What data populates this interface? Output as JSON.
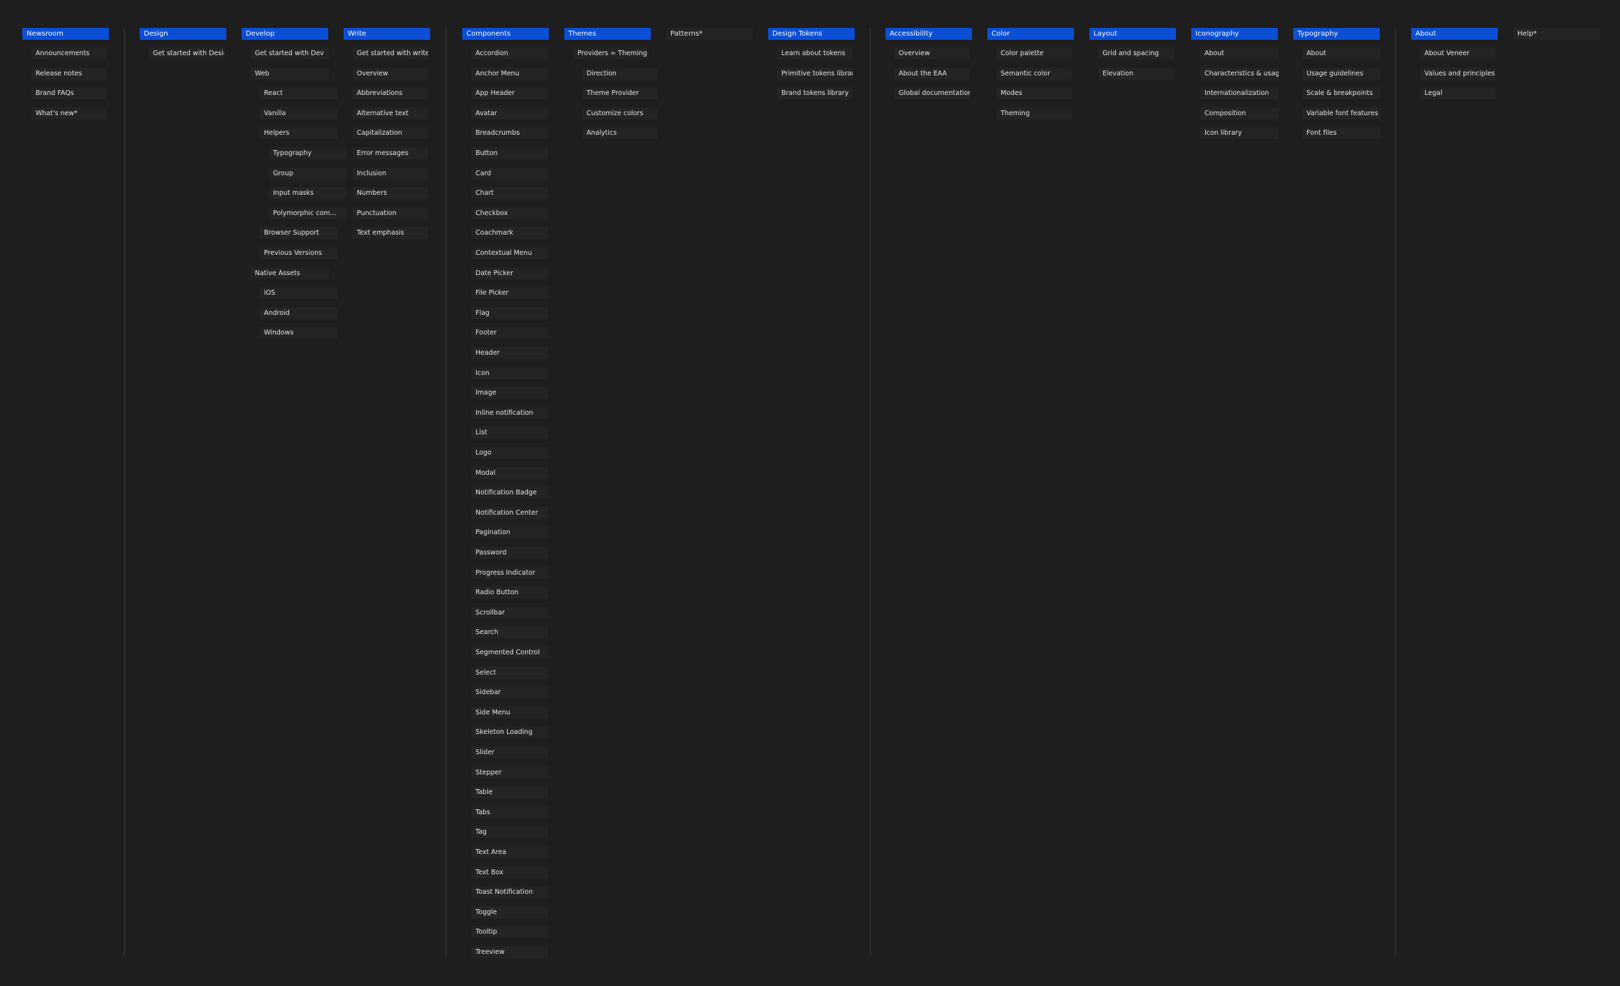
{
  "colors": {
    "background": "#1e1e1e",
    "section_header": "#0b4fd6",
    "item_box": "#242424",
    "divider": "#3e3e3e",
    "text": "#e4e4e4"
  },
  "sections": [
    {
      "id": "newsroom",
      "title": "Newsroom",
      "header_style": "primary",
      "items": [
        {
          "label": "Announcements",
          "level": 1
        },
        {
          "label": "Release notes",
          "level": 1
        },
        {
          "label": "Brand FAQs",
          "level": 1
        },
        {
          "label": "What's new*",
          "level": 1
        }
      ]
    },
    {
      "id": "design",
      "title": "Design",
      "header_style": "primary",
      "items": [
        {
          "label": "Get started with Design",
          "level": 1
        }
      ]
    },
    {
      "id": "develop",
      "title": "Develop",
      "header_style": "primary",
      "items": [
        {
          "label": "Get started with Dev",
          "level": 1
        },
        {
          "label": "Web",
          "level": 1
        },
        {
          "label": "React",
          "level": 2
        },
        {
          "label": "Vanilla",
          "level": 2
        },
        {
          "label": "Helpers",
          "level": 2
        },
        {
          "label": "Typography",
          "level": 3
        },
        {
          "label": "Group",
          "level": 3
        },
        {
          "label": "Input masks",
          "level": 3
        },
        {
          "label": "Polymorphic com...",
          "level": 3
        },
        {
          "label": "Browser Support",
          "level": 2
        },
        {
          "label": "Previous Versions",
          "level": 2
        },
        {
          "label": "Native Assets",
          "level": 1
        },
        {
          "label": "iOS",
          "level": 2
        },
        {
          "label": "Android",
          "level": 2
        },
        {
          "label": "Windows",
          "level": 2
        }
      ]
    },
    {
      "id": "write",
      "title": "Write",
      "header_style": "primary",
      "items": [
        {
          "label": "Get started with write",
          "level": 1
        },
        {
          "label": "Overview",
          "level": 1
        },
        {
          "label": "Abbreviations",
          "level": 1
        },
        {
          "label": "Alternative text",
          "level": 1
        },
        {
          "label": "Capitalization",
          "level": 1
        },
        {
          "label": "Error messages",
          "level": 1
        },
        {
          "label": "Inclusion",
          "level": 1
        },
        {
          "label": "Numbers",
          "level": 1
        },
        {
          "label": "Punctuation",
          "level": 1
        },
        {
          "label": "Text emphasis",
          "level": 1
        }
      ]
    },
    {
      "id": "components",
      "title": "Components",
      "header_style": "primary",
      "items": [
        {
          "label": "Accordion",
          "level": 1
        },
        {
          "label": "Anchor Menu",
          "level": 1
        },
        {
          "label": "App Header",
          "level": 1
        },
        {
          "label": "Avatar",
          "level": 1
        },
        {
          "label": "Breadcrumbs",
          "level": 1
        },
        {
          "label": "Button",
          "level": 1
        },
        {
          "label": "Card",
          "level": 1
        },
        {
          "label": "Chart",
          "level": 1
        },
        {
          "label": "Checkbox",
          "level": 1
        },
        {
          "label": "Coachmark",
          "level": 1
        },
        {
          "label": "Contextual Menu",
          "level": 1
        },
        {
          "label": "Date Picker",
          "level": 1
        },
        {
          "label": "File Picker",
          "level": 1
        },
        {
          "label": "Flag",
          "level": 1
        },
        {
          "label": "Footer",
          "level": 1
        },
        {
          "label": "Header",
          "level": 1
        },
        {
          "label": "Icon",
          "level": 1
        },
        {
          "label": "Image",
          "level": 1
        },
        {
          "label": "Inline notification",
          "level": 1
        },
        {
          "label": "List",
          "level": 1
        },
        {
          "label": "Logo",
          "level": 1
        },
        {
          "label": "Modal",
          "level": 1
        },
        {
          "label": "Notification Badge",
          "level": 1
        },
        {
          "label": "Notification Center",
          "level": 1
        },
        {
          "label": "Pagination",
          "level": 1
        },
        {
          "label": "Password",
          "level": 1
        },
        {
          "label": "Progress Indicator",
          "level": 1
        },
        {
          "label": "Radio Button",
          "level": 1
        },
        {
          "label": "Scrollbar",
          "level": 1
        },
        {
          "label": "Search",
          "level": 1
        },
        {
          "label": "Segmented Control",
          "level": 1
        },
        {
          "label": "Select",
          "level": 1
        },
        {
          "label": "Sidebar",
          "level": 1
        },
        {
          "label": "Side Menu",
          "level": 1
        },
        {
          "label": "Skeleton Loading",
          "level": 1
        },
        {
          "label": "Slider",
          "level": 1
        },
        {
          "label": "Stepper",
          "level": 1
        },
        {
          "label": "Table",
          "level": 1
        },
        {
          "label": "Tabs",
          "level": 1
        },
        {
          "label": "Tag",
          "level": 1
        },
        {
          "label": "Text Area",
          "level": 1
        },
        {
          "label": "Text Box",
          "level": 1
        },
        {
          "label": "Toast Notification",
          "level": 1
        },
        {
          "label": "Toggle",
          "level": 1
        },
        {
          "label": "Tooltip",
          "level": 1
        },
        {
          "label": "Treeview",
          "level": 1
        }
      ]
    },
    {
      "id": "themes",
      "title": "Themes",
      "header_style": "primary",
      "items": [
        {
          "label": "Providers = Theming",
          "level": 1
        },
        {
          "label": "Direction",
          "level": 2
        },
        {
          "label": "Theme Provider",
          "level": 2
        },
        {
          "label": "Customize colors",
          "level": 2
        },
        {
          "label": "Analytics",
          "level": 2
        }
      ]
    },
    {
      "id": "patterns",
      "title": "Patterns*",
      "header_style": "plain",
      "items": []
    },
    {
      "id": "design-tokens",
      "title": "Design Tokens",
      "header_style": "primary",
      "items": [
        {
          "label": "Learn about tokens",
          "level": 1
        },
        {
          "label": "Primitive tokens library",
          "level": 1
        },
        {
          "label": "Brand tokens library",
          "level": 1
        }
      ]
    },
    {
      "id": "accessibility",
      "title": "Accessibility",
      "header_style": "primary",
      "items": [
        {
          "label": "Overview",
          "level": 1
        },
        {
          "label": "About the EAA",
          "level": 1
        },
        {
          "label": "Global documentation*",
          "level": 1
        }
      ]
    },
    {
      "id": "color",
      "title": "Color",
      "header_style": "primary",
      "items": [
        {
          "label": "Color palette",
          "level": 1
        },
        {
          "label": "Semantic color",
          "level": 1
        },
        {
          "label": "Modes",
          "level": 1
        },
        {
          "label": "Theming",
          "level": 1
        }
      ]
    },
    {
      "id": "layout",
      "title": "Layout",
      "header_style": "primary",
      "items": [
        {
          "label": "Grid and spacing",
          "level": 1
        },
        {
          "label": "Elevation",
          "level": 1
        }
      ]
    },
    {
      "id": "iconography",
      "title": "Iconography",
      "header_style": "primary",
      "items": [
        {
          "label": "About",
          "level": 1
        },
        {
          "label": "Characteristics & usage",
          "level": 1
        },
        {
          "label": "Internationalization",
          "level": 1
        },
        {
          "label": "Composition",
          "level": 1
        },
        {
          "label": "Icon library",
          "level": 1
        }
      ]
    },
    {
      "id": "typography",
      "title": "Typography",
      "header_style": "primary",
      "items": [
        {
          "label": "About",
          "level": 1
        },
        {
          "label": "Usage guidelines",
          "level": 1
        },
        {
          "label": "Scale & breakpoints",
          "level": 1
        },
        {
          "label": "Variable font features",
          "level": 1
        },
        {
          "label": "Font files",
          "level": 1
        }
      ]
    },
    {
      "id": "about",
      "title": "About",
      "header_style": "primary",
      "items": [
        {
          "label": "About Veneer",
          "level": 1
        },
        {
          "label": "Values and principles",
          "level": 1
        },
        {
          "label": "Legal",
          "level": 1
        }
      ]
    },
    {
      "id": "help",
      "title": "Help*",
      "header_style": "plain",
      "items": []
    }
  ]
}
